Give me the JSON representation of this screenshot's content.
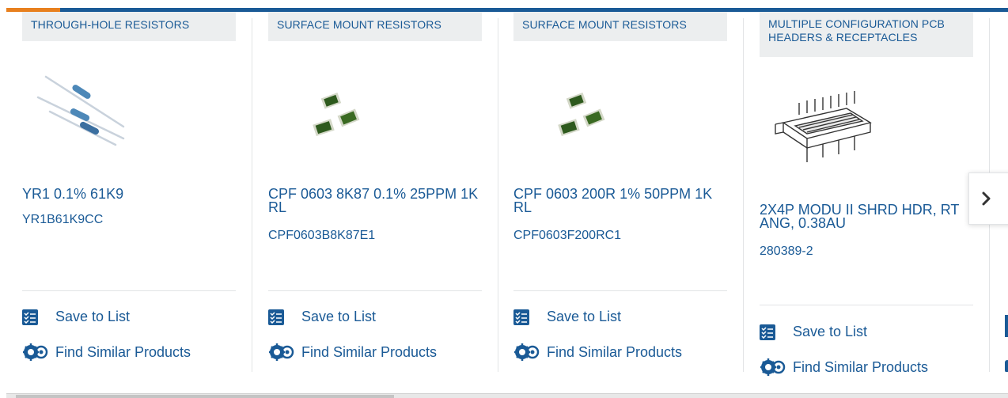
{
  "products": [
    {
      "category": "THROUGH-HOLE RESISTORS",
      "name": "YR1 0.1% 61K9",
      "part_number": "YR1B61K9CC",
      "image": "through-hole-resistors-image"
    },
    {
      "category": "SURFACE MOUNT RESISTORS",
      "name": "CPF 0603 8K87 0.1% 25PPM 1K RL",
      "part_number": "CPF0603B8K87E1",
      "image": "smd-resistors-image"
    },
    {
      "category": "SURFACE MOUNT RESISTORS",
      "name": "CPF 0603 200R 1% 50PPM 1K RL",
      "part_number": "CPF0603F200RC1",
      "image": "smd-resistors-image"
    },
    {
      "category": "MULTIPLE CONFIGURATION PCB HEADERS & RECEPTACLES",
      "name": "2X4P MODU II SHRD HDR, RT ANG, 0.38AU",
      "part_number": "280389-2",
      "image": "pcb-header-image"
    }
  ],
  "actions": {
    "save_to_list": "Save to List",
    "find_similar": "Find Similar Products"
  },
  "icons": {
    "save": "list-check-icon",
    "similar": "gears-icon",
    "next": "chevron-right-icon"
  },
  "colors": {
    "brand_blue": "#1a5a96",
    "accent_orange": "#e8801e",
    "tab_bg": "#eceeef"
  }
}
